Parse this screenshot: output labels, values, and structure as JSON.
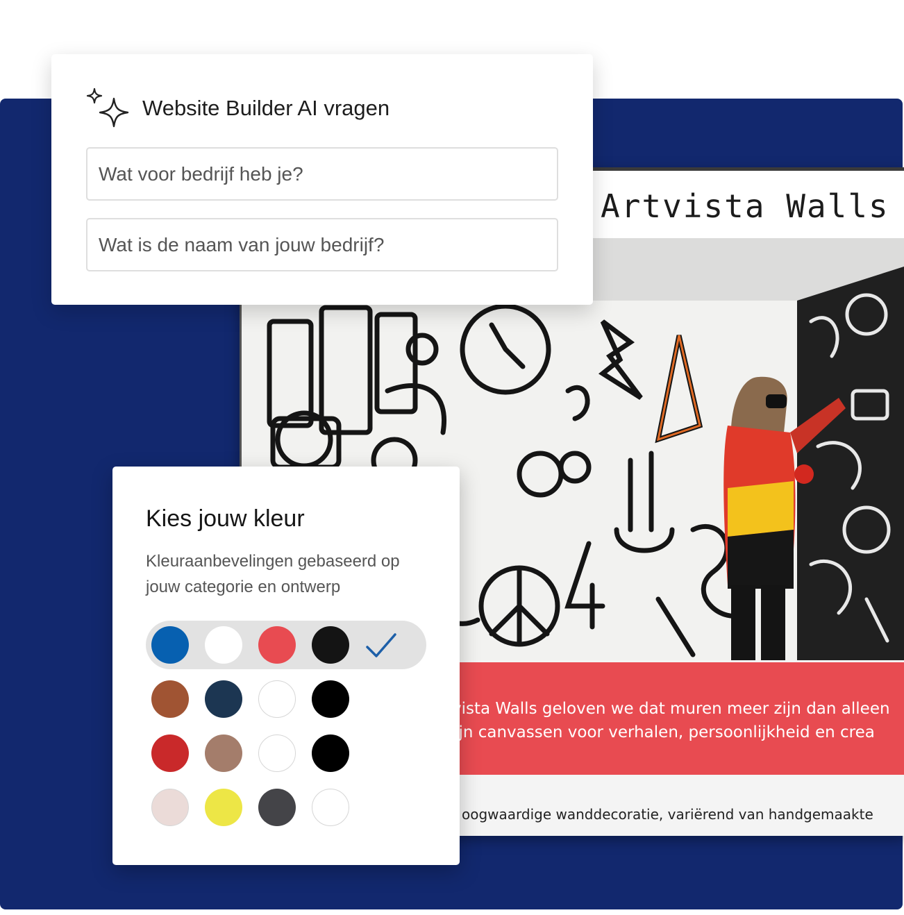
{
  "ai_prompt": {
    "title": "Website Builder AI vragen",
    "icon": "sparkle-icon",
    "fields": [
      {
        "placeholder": "Wat voor bedrijf heb je?"
      },
      {
        "placeholder": "Wat is de naam van jouw bedrijf?"
      }
    ]
  },
  "preview": {
    "site_title": "Artvista Walls",
    "banner_lines": [
      "tvista Walls geloven we dat muren meer zijn dan alleen",
      " zijn canvassen voor verhalen, persoonlijkheid en crea"
    ],
    "footer_text": "oogwaardige wanddecoratie, variërend van handgemaakte"
  },
  "color_picker": {
    "title": "Kies jouw kleur",
    "subtitle": "Kleuraanbevelingen gebaseerd op jouw categorie en ontwerp",
    "selected_row": 0,
    "rows": [
      [
        "#0760b0",
        "#ffffff",
        "#e84b51",
        "#141414"
      ],
      [
        "#a05433",
        "#1c3652",
        "#ffffff",
        "#000000"
      ],
      [
        "#c9292a",
        "#a47d6b",
        "#ffffff",
        "#000000"
      ],
      [
        "#ebdbd8",
        "#ede646",
        "#444448",
        "#ffffff"
      ]
    ],
    "check_color": "#1d5fa8"
  },
  "colors": {
    "navy_background": "#12286e",
    "banner_red": "#e84b51"
  }
}
